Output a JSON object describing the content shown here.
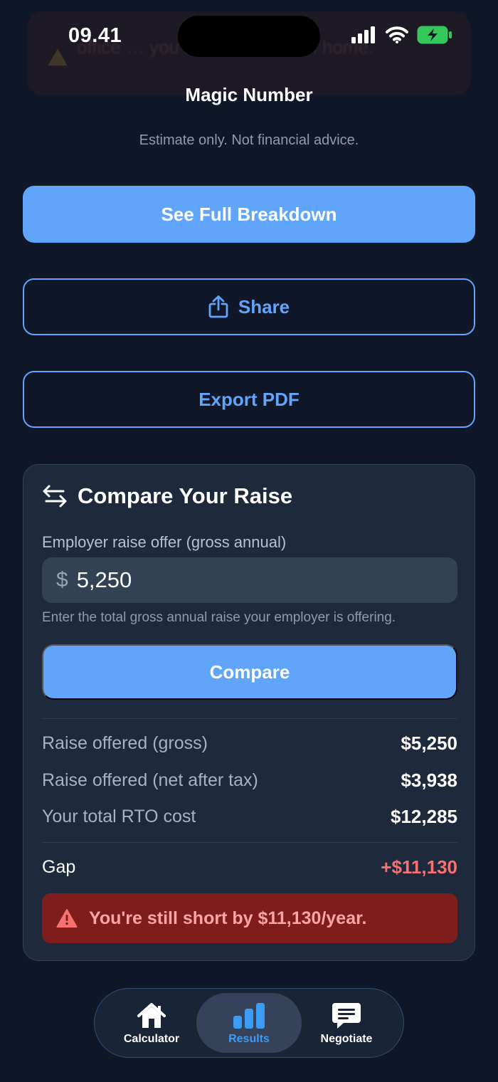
{
  "status_bar": {
    "time": "09.41"
  },
  "background_banner": {
    "text": "office … you an extra … from home."
  },
  "results": {
    "section_title": "Magic Number",
    "disclaimer": "Estimate only. Not financial advice.",
    "see_full_breakdown_label": "See Full Breakdown",
    "share_label": "Share",
    "export_pdf_label": "Export PDF"
  },
  "compare": {
    "title": "Compare Your Raise",
    "field_label": "Employer raise offer (gross annual)",
    "currency_prefix": "$",
    "input_value": "5,250",
    "hint": "Enter the total gross annual raise your employer is offering.",
    "button_label": "Compare",
    "rows": [
      {
        "label": "Raise offered (gross)",
        "value": "$5,250"
      },
      {
        "label": "Raise offered (net after tax)",
        "value": "$3,938"
      },
      {
        "label": "Your total RTO cost",
        "value": "$12,285"
      }
    ],
    "gap_label": "Gap",
    "gap_value": "+$11,130",
    "alert_text": "You're still short by $11,130/year."
  },
  "tabs": [
    {
      "label": "Calculator",
      "icon": "house-icon",
      "active": false
    },
    {
      "label": "Results",
      "icon": "bar-chart-icon",
      "active": true
    },
    {
      "label": "Negotiate",
      "icon": "chat-bubble-icon",
      "active": false
    }
  ],
  "colors": {
    "background": "#0f1729",
    "card": "#1e293b",
    "accent": "#60a5fa",
    "danger_bg": "#7f1d1d",
    "danger_text": "#fca5a5",
    "gap_red": "#f87171",
    "battery_green": "#34c759"
  }
}
